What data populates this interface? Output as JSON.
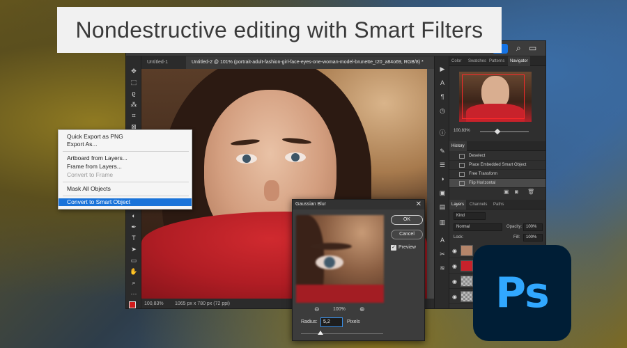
{
  "banner": {
    "title": "Nondestructive editing with Smart Filters"
  },
  "document_tabs": [
    {
      "label": "Untitled-1"
    },
    {
      "label": "Untitled-2 @ 101% (portrait-adult-fashion-girl-face-eyes-one-woman-model-brunette_t20_a84o69, RGB/8) *"
    }
  ],
  "status_bar": {
    "zoom": "100,83%",
    "dimensions": "1065 px x 780 px (72 ppi)"
  },
  "right_panels": {
    "top_tabs": [
      "Color",
      "Swatches",
      "Patterns",
      "Navigator"
    ],
    "navigator_zoom": "100,83%",
    "history": {
      "title": "History",
      "items": [
        "Deselect",
        "Place Embedded Smart Object",
        "Free Transform",
        "Flip Horizontal"
      ]
    },
    "layers": {
      "tabs": [
        "Layers",
        "Channels",
        "Paths"
      ],
      "filter_kind": "Kind",
      "blend_mode": "Normal",
      "opacity_label": "Opacity:",
      "opacity_value": "100%",
      "lock_label": "Lock:",
      "fill_label": "Fill:",
      "fill_value": "100%"
    }
  },
  "context_menu": {
    "items": [
      {
        "label": "Quick Export as PNG",
        "state": "normal"
      },
      {
        "label": "Export As...",
        "state": "normal"
      },
      {
        "label": "Artboard from Layers...",
        "state": "normal"
      },
      {
        "label": "Frame from Layers...",
        "state": "normal"
      },
      {
        "label": "Convert to Frame",
        "state": "disabled"
      },
      {
        "label": "Mask All Objects",
        "state": "normal"
      },
      {
        "label": "Convert to Smart Object",
        "state": "highlighted"
      }
    ]
  },
  "gaussian_blur_dialog": {
    "title": "Gaussian Blur",
    "ok_label": "OK",
    "cancel_label": "Cancel",
    "preview_label": "Preview",
    "preview_checked": true,
    "zoom": "100%",
    "radius_label": "Radius:",
    "radius_value": "5,2",
    "radius_unit": "Pixels"
  },
  "logo": {
    "text": "Ps"
  },
  "colors": {
    "accent_blue": "#1a73d9",
    "ps_logo_bg": "#001e36",
    "ps_logo_fg": "#31a8ff",
    "foreground_swatch": "#d01c1c"
  }
}
